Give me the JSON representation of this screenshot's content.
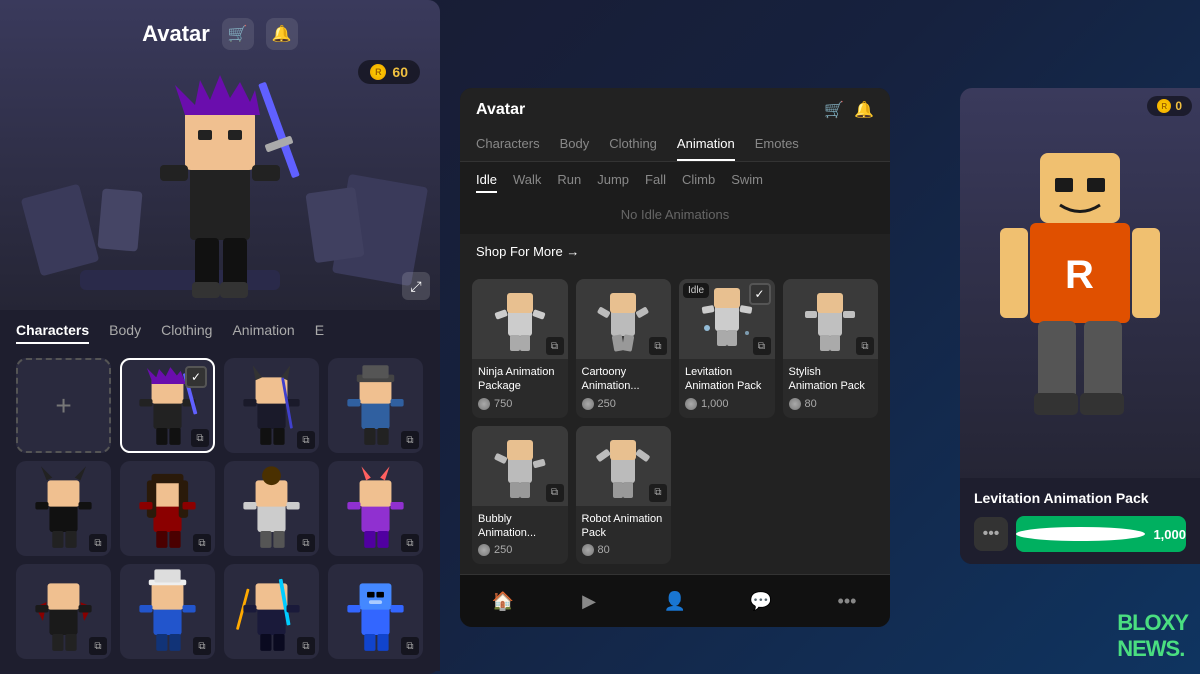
{
  "left_panel": {
    "title": "Avatar",
    "coin_amount": "60",
    "tabs": [
      {
        "label": "Characters",
        "active": true
      },
      {
        "label": "Body",
        "active": false
      },
      {
        "label": "Clothing",
        "active": false
      },
      {
        "label": "Animation",
        "active": false
      },
      {
        "label": "E",
        "active": false
      }
    ],
    "expand_icon": "⤢"
  },
  "overlay": {
    "title": "Avatar",
    "nav_tabs": [
      "Characters",
      "Body",
      "Clothing",
      "Animation",
      "Emotes"
    ],
    "active_nav": "Animation",
    "anim_tabs": [
      "Idle",
      "Walk",
      "Run",
      "Jump",
      "Fall",
      "Climb",
      "Swim"
    ],
    "active_anim": "Idle",
    "no_anim_text": "No Idle Animations",
    "shop_label": "Shop For More →",
    "items": [
      {
        "name": "Ninja Animation Package",
        "price": "750",
        "label": "",
        "selected": false
      },
      {
        "name": "Cartoony Animation...",
        "price": "250",
        "label": "",
        "selected": false
      },
      {
        "name": "Levitation Animation Pack",
        "price": "1,000",
        "label": "Idle",
        "selected": true
      },
      {
        "name": "Stylish Animation Pack",
        "price": "80",
        "label": "",
        "selected": false
      },
      {
        "name": "Bubbly Animation...",
        "price": "250",
        "label": "",
        "selected": false
      },
      {
        "name": "Robot Animation Pack",
        "price": "80",
        "label": "",
        "selected": false
      }
    ],
    "bottom_nav": [
      "🏠",
      "▶",
      "👤",
      "💬",
      "•••"
    ]
  },
  "right_panel": {
    "coin_amount": "0",
    "item_name": "Levitation Animation Pack",
    "price": "1,000"
  },
  "watermark": {
    "text1": "BLOXY",
    "text2": "NEWS."
  }
}
